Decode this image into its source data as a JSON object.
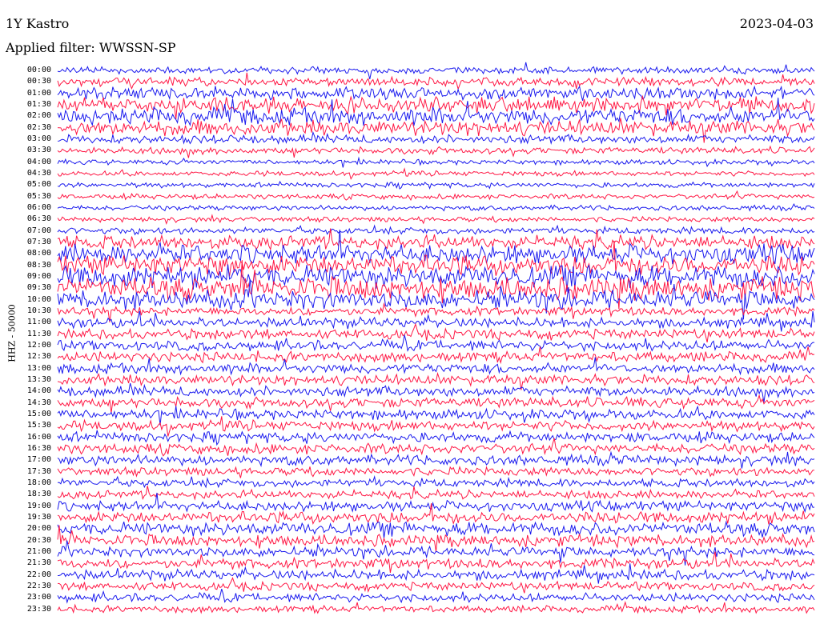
{
  "header": {
    "station": "1Y Kastro",
    "filter": "Applied filter: WWSSN-SP",
    "date": "2023-04-03"
  },
  "chart_data": {
    "type": "line",
    "title": "1Y Kastro",
    "subtitle": "Applied filter: WWSSN-SP",
    "date": "2023-04-03",
    "ylabel": "HHZ - 50000",
    "xlabel": "",
    "row_labels": [
      "00:00",
      "00:30",
      "01:00",
      "01:30",
      "02:00",
      "02:30",
      "03:00",
      "03:30",
      "04:00",
      "04:30",
      "05:00",
      "05:30",
      "06:00",
      "06:30",
      "07:00",
      "07:30",
      "08:00",
      "08:30",
      "09:00",
      "09:30",
      "10:00",
      "10:30",
      "11:00",
      "11:30",
      "12:00",
      "12:30",
      "13:00",
      "13:30",
      "14:00",
      "14:30",
      "15:00",
      "15:30",
      "16:00",
      "16:30",
      "17:00",
      "17:30",
      "18:00",
      "18:30",
      "19:00",
      "19:30",
      "20:00",
      "20:30",
      "21:00",
      "21:30",
      "22:00",
      "22:30",
      "23:00",
      "23:30"
    ],
    "row_minutes": 30,
    "series_colors": [
      "#1a1aee",
      "#ff1744"
    ],
    "relative_amplitude": [
      4,
      5,
      7,
      9,
      10,
      9,
      5,
      4,
      3,
      3,
      3,
      3,
      3,
      3,
      4,
      8,
      11,
      12,
      13,
      13,
      11,
      5,
      6,
      6,
      6,
      6,
      6,
      6,
      6,
      6,
      6,
      6,
      6,
      6,
      6,
      5,
      5,
      5,
      6,
      7,
      8,
      7,
      6,
      6,
      6,
      5,
      5,
      4
    ],
    "grid": false
  }
}
